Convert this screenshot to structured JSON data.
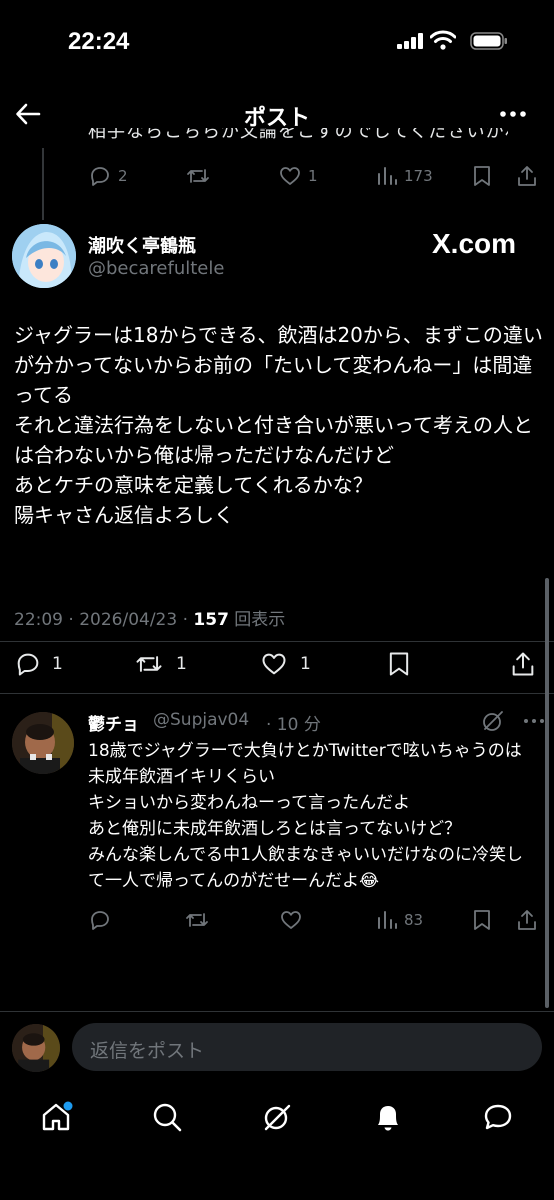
{
  "status": {
    "time": "22:24"
  },
  "header": {
    "title": "ポスト",
    "back_icon": "back-arrow-icon",
    "more_icon": "more-icon"
  },
  "prev_post": {
    "clipped_text": "相手ならこちらが文論をこすのでしてくださいかね😅",
    "replies": "2",
    "reposts": "",
    "likes": "1",
    "views": "173"
  },
  "main_post": {
    "display_name": "潮吹く亭鶴瓶",
    "handle": "@becarefultele",
    "badge": "X.com",
    "body": "ジャグラーは18からできる、飲酒は20から、まずこの違いが分かってないからお前の「たいして変わんねー」は間違ってる\nそれと違法行為をしないと付き合いが悪いって考えの人とは合わないから俺は帰っただけなんだけど\nあとケチの意味を定義してくれるかな？\n陽キャさん返信よろしく",
    "time": "22:09 · 2026/04/23 · ",
    "views_count": "157",
    "views_label": " 回表示",
    "replies": "1",
    "reposts": "1",
    "likes": "1"
  },
  "reply": {
    "display_name": "鬱チョ",
    "handle": "@Supjav04",
    "time": "· 10 分",
    "body": "18歳でジャグラーで大負けとかTwitterで呟いちゃうのは未成年飲酒イキリくらい\nキショいから変わんねーって言ったんだよ\nあと俺別に未成年飲酒しろとは言ってないけど？\nみんな楽しんでる中1人飲まなきゃいいだけなのに冷笑して一人で帰ってんのがだせーんだよ😂",
    "views": "83"
  },
  "compose": {
    "placeholder": "返信をポスト"
  },
  "tabs": [
    {
      "name": "home",
      "icon": "home-icon"
    },
    {
      "name": "search",
      "icon": "search-icon"
    },
    {
      "name": "grok",
      "icon": "grok-icon"
    },
    {
      "name": "notifications",
      "icon": "bell-icon"
    },
    {
      "name": "messages",
      "icon": "messages-icon"
    }
  ],
  "colors": {
    "background": "#000000",
    "text": "#e7e9ea",
    "muted": "#71767b",
    "accent": "#1d9bf0"
  }
}
